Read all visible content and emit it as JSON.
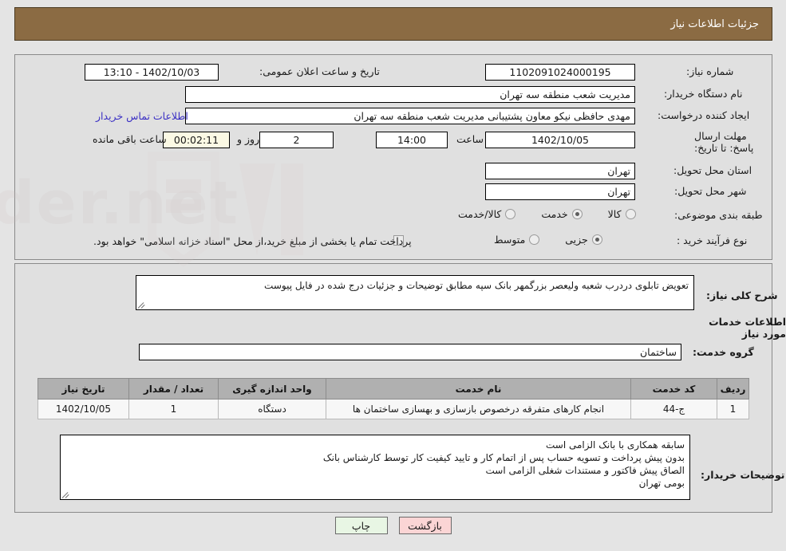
{
  "header": {
    "title": "جزئیات اطلاعات نیاز"
  },
  "colors": {
    "header_bar": "#8b6b43",
    "panel_bg": "#e0e0e0",
    "page_bg": "#e4e4e4",
    "link": "#3b30c4",
    "timer_bg": "#fbf9e4",
    "table_header": "#b0b0b0",
    "btn_print": "#e8f6e4",
    "btn_back": "#fbd5d5"
  },
  "watermark": {
    "text": "AriaTender.net"
  },
  "form": {
    "need_number": {
      "label": "شماره نیاز:",
      "value": "1102091024000195"
    },
    "announce_datetime": {
      "label": "تاریخ و ساعت اعلان عمومی:",
      "value": "1402/10/03 - 13:10"
    },
    "buyer_org": {
      "label": "نام دستگاه خریدار:",
      "value": "مدیریت شعب منطقه سه تهران"
    },
    "request_creator": {
      "label": "ایجاد کننده درخواست:",
      "value": "مهدی حافظی نیکو معاون پشتیبانی مدیریت شعب منطقه سه تهران"
    },
    "contact_link": {
      "label": "اطلاعات تماس خریدار"
    },
    "deadline": {
      "label": "مهلت ارسال پاسخ: تا تاریخ:",
      "date": "1402/10/05",
      "time_label": "ساعت",
      "time": "14:00",
      "days": "2",
      "days_suffix": "روز و",
      "countdown": "00:02:11",
      "countdown_suffix": "ساعت باقی مانده"
    },
    "province": {
      "label": "استان محل تحویل:",
      "value": "تهران"
    },
    "city": {
      "label": "شهر محل تحویل:",
      "value": "تهران"
    },
    "category": {
      "label": "طبقه بندی موضوعی:",
      "options": [
        "کالا",
        "خدمت",
        "کالا/خدمت"
      ],
      "selected": "خدمت"
    },
    "purchase_type": {
      "label": "نوع فرآیند خرید :",
      "options": [
        "جزیی",
        "متوسط"
      ],
      "selected": "جزیی",
      "treasury_checkbox_label": "پرداخت تمام یا بخشی از مبلغ خرید،از محل \"اسناد خزانه اسلامی\" خواهد بود.",
      "treasury_checked": false
    }
  },
  "description": {
    "label": "شرح کلی نیاز:",
    "value": "تعویض تابلوی دردرب شعبه ولیعصر بزرگمهر بانک سپه مطابق توضیحات و جزئیات درج شده در فایل پیوست"
  },
  "services_section": {
    "heading": "اطلاعات خدمات مورد نیاز",
    "service_group": {
      "label": "گروه خدمت:",
      "value": "ساختمان"
    },
    "table": {
      "columns": [
        "ردیف",
        "کد خدمت",
        "نام خدمت",
        "واحد اندازه گیری",
        "تعداد / مقدار",
        "تاریخ نیاز"
      ],
      "rows": [
        {
          "radif": "1",
          "code": "ج-44",
          "name": "انجام کارهای متفرقه درخصوص بازسازی و بهسازی ساختمان ها",
          "unit": "دستگاه",
          "quantity": "1",
          "need_date": "1402/10/05"
        }
      ]
    }
  },
  "buyer_notes": {
    "label": "توضیحات خریدار:",
    "lines": [
      "سابقه همکاری با بانک الزامی است",
      "بدون پیش پرداخت و تسویه حساب پس از اتمام کار و تایید کیفیت کار توسط کارشناس بانک",
      "الصاق پیش فاکتور و مستندات شغلی الزامی است",
      "بومی تهران"
    ]
  },
  "footer": {
    "print_label": "چاپ",
    "back_label": "بازگشت"
  }
}
